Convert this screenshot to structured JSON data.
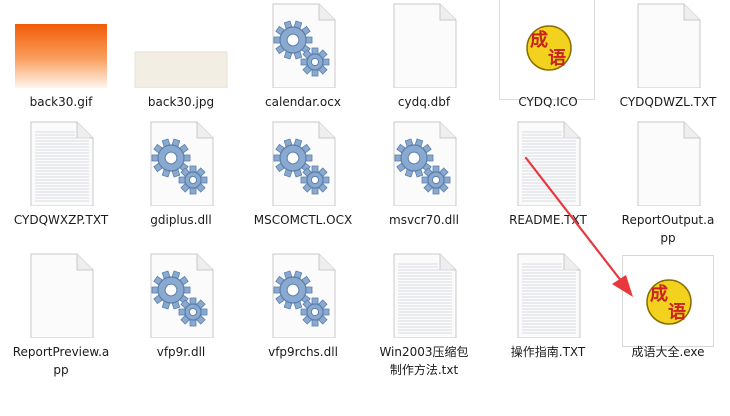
{
  "files": [
    {
      "name": "back30.gif",
      "icon": "gif-thumbnail-icon"
    },
    {
      "name": "back30.jpg",
      "icon": "jpg-thumbnail-icon"
    },
    {
      "name": "calendar.ocx",
      "icon": "gear-file-icon"
    },
    {
      "name": "cydq.dbf",
      "icon": "blank-file-icon"
    },
    {
      "name": "CYDQ.ICO",
      "icon": "chengyu-ico-icon"
    },
    {
      "name": "CYDQDWZL.TXT",
      "icon": "blank-file-icon"
    },
    {
      "name": "CYDQWXZP.TXT",
      "icon": "text-file-icon"
    },
    {
      "name": "gdiplus.dll",
      "icon": "gear-file-icon"
    },
    {
      "name": "MSCOMCTL.OCX",
      "icon": "gear-file-icon"
    },
    {
      "name": "msvcr70.dll",
      "icon": "gear-file-icon"
    },
    {
      "name": "README.TXT",
      "icon": "text-file-icon"
    },
    {
      "name": "ReportOutput.app",
      "icon": "blank-file-icon"
    },
    {
      "name": "ReportPreview.app",
      "icon": "blank-file-icon"
    },
    {
      "name": "vfp9r.dll",
      "icon": "gear-file-icon"
    },
    {
      "name": "vfp9rchs.dll",
      "icon": "gear-file-icon"
    },
    {
      "name": "Win2003压缩包制作方法.txt",
      "icon": "text-file-icon"
    },
    {
      "name": "操作指南.TXT",
      "icon": "text-file-icon"
    },
    {
      "name": "成语大全.exe",
      "icon": "chengyu-exe-icon"
    }
  ],
  "colors": {
    "arrow": "#e8383d",
    "gear": "#8aa9cf",
    "gear_dark": "#5b7fae",
    "ico_yellow": "#f2d21e",
    "ico_red": "#c8231e"
  }
}
